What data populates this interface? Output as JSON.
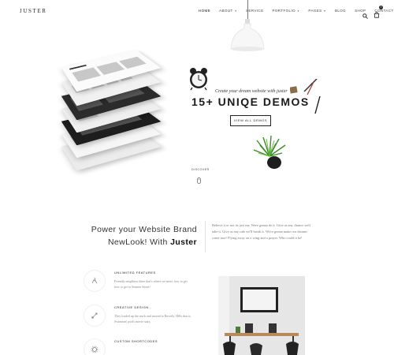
{
  "header": {
    "logo": "JUSTER",
    "nav": [
      {
        "label": "HOME",
        "caret": false
      },
      {
        "label": "ABOUT",
        "caret": true
      },
      {
        "label": "SERVICE",
        "caret": false
      },
      {
        "label": "PORTFOLIO",
        "caret": true
      },
      {
        "label": "PAGES",
        "caret": true
      },
      {
        "label": "BLOG",
        "caret": false
      },
      {
        "label": "SHOP",
        "caret": false
      },
      {
        "label": "CONTACT",
        "caret": false
      }
    ],
    "cart_count": "0",
    "icons": [
      "search-icon",
      "cart-icon"
    ]
  },
  "hero": {
    "subtitle": "Create your dream website with juster",
    "title": "15+ UNIQE DEMOS",
    "button": "VIEW ALL DEMOS",
    "discover": "DISCOVER",
    "icons": [
      "lamp-icon",
      "alarm-clock-icon",
      "plant-icon",
      "pencil-cup-icon",
      "mouse-scroll-icon"
    ]
  },
  "intro": {
    "title_line1": "Power your Website Brand",
    "title_line2_prefix": "NewLook! With",
    "title_line2_brand": "Juster",
    "text": "Believe it or not its just me. Were gonna do it. Give us any chance well take it. Give us any rule we'll break it. We're gonna make our dreams come true! Flying away on a wing and a prayer. Who could it be!"
  },
  "features": [
    {
      "title": "UNLIMITED FEATURES",
      "desc": "Friendly neighbors there that's where we meet. how to get how to get to Sesame Street!",
      "icon": "palette-icon"
    },
    {
      "title": "CREATIVE DESIGN",
      "desc": "They loaded up the truck and moved to Beverly. Hills that is. Swimmin' pools movie stars.",
      "icon": "pen-tool-icon"
    },
    {
      "title": "CUSTOM SHORTCODES",
      "desc": "",
      "icon": "gear-icon"
    }
  ],
  "colors": {
    "accent": "#222222",
    "muted": "#888888",
    "hero_bg": "#f0f0f0"
  }
}
